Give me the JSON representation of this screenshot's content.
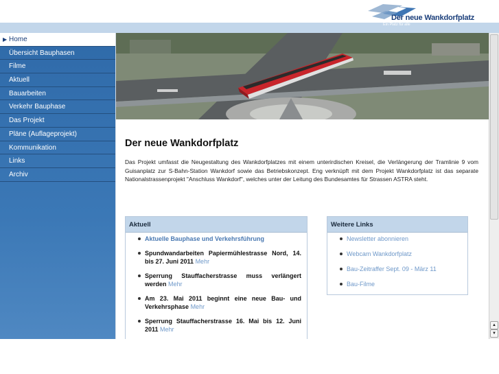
{
  "header": {
    "logo_title": "Der neue Wankdorfplatz",
    "logo_subtitle": "Ein Platz für alle"
  },
  "sidebar": {
    "items": [
      {
        "label": "Home",
        "active": true
      },
      {
        "label": "Übersicht Bauphasen"
      },
      {
        "label": "Filme"
      },
      {
        "label": "Aktuell"
      },
      {
        "label": "Bauarbeiten"
      },
      {
        "label": "Verkehr Bauphase"
      },
      {
        "label": "Das Projekt"
      },
      {
        "label": "Pläne (Auflageprojekt)"
      },
      {
        "label": "Kommunikation"
      },
      {
        "label": "Links"
      },
      {
        "label": "Archiv"
      }
    ]
  },
  "main": {
    "title": "Der neue Wankdorfplatz",
    "intro": "Das Projekt umfasst die Neugestaltung des Wankdorfplatzes mit einem unterirdischen Kreisel, die Verlängerung der Tramlinie 9 vom Guisanplatz zur S-Bahn-Station Wankdorf sowie das Betriebskonzept. Eng verknüpft mit dem Projekt Wankdorfplatz ist das separate Nationalstrassenprojekt \"Anschluss Wankdorf\", welches unter der Leitung des Bundesamtes für Strassen ASTRA steht."
  },
  "aktuell": {
    "heading": "Aktuell",
    "items": [
      {
        "text": "Aktuelle Bauphase und Verkehrsführung",
        "more": ""
      },
      {
        "text": "Spundwandarbeiten Papiermühlestrasse Nord, 14. bis 27. Juni 2011",
        "more": "Mehr"
      },
      {
        "text": "Sperrung Stauffacherstrasse muss verlängert werden",
        "more": "Mehr"
      },
      {
        "text": "Am 23. Mai 2011 beginnt eine neue Bau- und Verkehrsphase",
        "more": "Mehr"
      },
      {
        "text": "Sperrung Stauffacherstrasse 16. Mai bis 12. Juni 2011",
        "more": "Mehr"
      }
    ]
  },
  "weitere_links": {
    "heading": "Weitere Links",
    "items": [
      "Newsletter abonnieren",
      "Webcam Wankdorfplatz",
      "Bau-Zeitraffer Sept. 09 - März 11",
      "Bau-Filme"
    ]
  },
  "icons": {
    "nav_active": "play-arrow-icon",
    "scroll_up": "arrow-up-icon",
    "scroll_down": "arrow-down-icon"
  },
  "colors": {
    "sidebar": "#3b78b6",
    "header_stripe": "#c2d6ea",
    "link": "#6e98c9",
    "brand": "#1a3e7a"
  }
}
